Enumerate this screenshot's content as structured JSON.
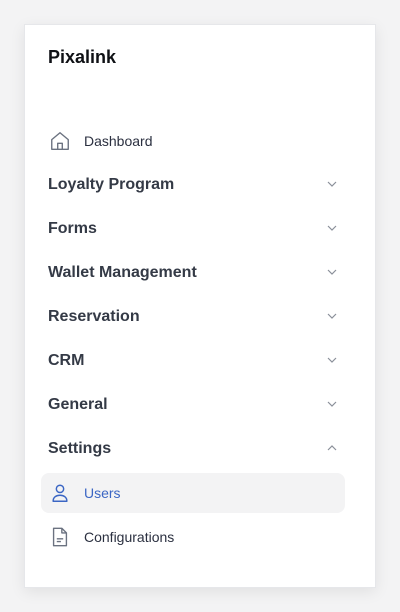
{
  "brand": "Pixalink",
  "nav": {
    "dashboard": {
      "label": "Dashboard",
      "icon": "home-icon"
    },
    "groups": [
      {
        "label": "Loyalty Program",
        "expanded": false
      },
      {
        "label": "Forms",
        "expanded": false
      },
      {
        "label": "Wallet Management",
        "expanded": false
      },
      {
        "label": "Reservation",
        "expanded": false
      },
      {
        "label": "CRM",
        "expanded": false
      },
      {
        "label": "General",
        "expanded": false
      },
      {
        "label": "Settings",
        "expanded": true
      }
    ],
    "settings_items": [
      {
        "label": "Users",
        "icon": "user-icon",
        "active": true
      },
      {
        "label": "Configurations",
        "icon": "file-icon",
        "active": false
      }
    ]
  },
  "colors": {
    "accent": "#3b66c4",
    "text": "#343a46",
    "active_bg": "#f3f3f4"
  }
}
